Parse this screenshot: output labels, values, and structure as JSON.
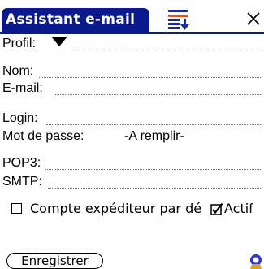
{
  "window": {
    "title": "Assistant e-mail",
    "title_color": "#0a1a8c",
    "menu_icon": "menu-list-icon",
    "close_icon": "close-icon"
  },
  "form": {
    "profil": {
      "label": "Profil:",
      "value": ""
    },
    "nom": {
      "label": "Nom:",
      "value": ""
    },
    "email": {
      "label": "E-mail:",
      "value": ""
    },
    "login": {
      "label": "Login:",
      "value": ""
    },
    "password": {
      "label": "Mot de passe:",
      "value": "-A remplir-"
    },
    "pop3": {
      "label": "POP3:",
      "value": ""
    },
    "smtp": {
      "label": "SMTP:",
      "value": ""
    }
  },
  "options": {
    "sender_account": {
      "label": "Compte expéditeur par dé",
      "checked": false
    },
    "active": {
      "label": "Actif",
      "checked": true
    }
  },
  "actions": {
    "save_label": "Enregistrer"
  },
  "status": {
    "icon": "network-status-icon"
  }
}
